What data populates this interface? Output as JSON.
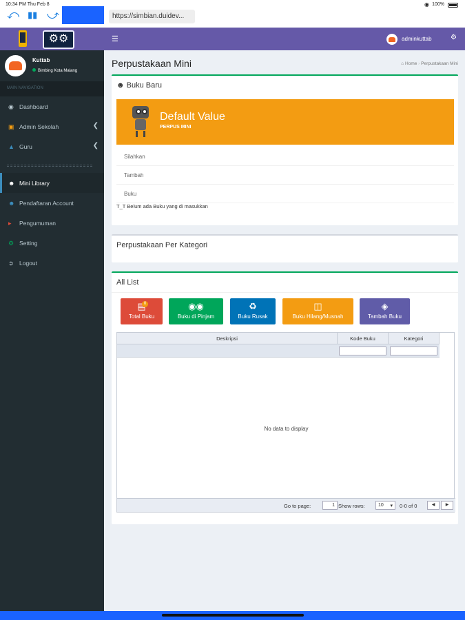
{
  "status_bar": {
    "time": "10:34 PM  Thu Feb 8",
    "battery": "100%"
  },
  "browser": {
    "url": "https://simbian.duidev..."
  },
  "sidebar": {
    "user": {
      "name": "Kuttab",
      "status": "Bimbing Kota Malang"
    },
    "nav_header": "MAIN NAVIGATION",
    "items": [
      {
        "label": "Dashboard",
        "icon": "dashboard-icon"
      },
      {
        "label": "Admin Sekolah",
        "icon": "briefcase-icon"
      },
      {
        "label": "Guru",
        "icon": "graduation-cap-icon"
      },
      {
        "label": "Mini Library",
        "icon": "users-icon"
      },
      {
        "label": "Pendaftaran Account",
        "icon": "user-plus-icon"
      },
      {
        "label": "Pengumuman",
        "icon": "bullhorn-icon"
      },
      {
        "label": "Setting",
        "icon": "gears-icon"
      },
      {
        "label": "Logout",
        "icon": "logout-icon"
      }
    ]
  },
  "topbar": {
    "username": "adminkuttab"
  },
  "page": {
    "title": "Perpustakaan Mini",
    "breadcrumb": {
      "home": "Home",
      "current": "Perpustakaan Mini"
    }
  },
  "buku_baru": {
    "title": "Buku Baru",
    "banner_title": "Default Value",
    "banner_subtitle": "PERPUS MINI",
    "rows": [
      "Silahkan",
      "Tambah",
      "Buku"
    ],
    "empty_note": "T_T Belum ada Buku yang di masukkan"
  },
  "kategori": {
    "title": "Perpustakaan Per Kategori"
  },
  "all_list": {
    "title": "All List",
    "buttons": [
      {
        "label": "Total Buku",
        "color": "#dd4b39",
        "icon": "book-icon",
        "badge": "0"
      },
      {
        "label": "Buku di Pinjam",
        "color": "#00a65a",
        "icon": "binoculars-icon"
      },
      {
        "label": "Buku Rusak",
        "color": "#0073b7",
        "icon": "recycle-icon"
      },
      {
        "label": "Buku Hilang/Musnah",
        "color": "#f39c12",
        "icon": "trash-icon"
      },
      {
        "label": "Tambah Buku",
        "color": "#605ca8",
        "icon": "tags-icon"
      }
    ],
    "table": {
      "columns": [
        "Deskripsi",
        "Kode Buku",
        "Kategori"
      ],
      "empty_message": "No data to display",
      "pager": {
        "go_to_label": "Go to page:",
        "page_value": "1",
        "show_rows_label": "Show rows:",
        "rows_value": "10",
        "range": "0-0 of 0"
      }
    }
  },
  "colors": {
    "header_purple": "#6559a8",
    "sidebar_dark": "#222d32",
    "accent_green": "#00a65a",
    "banner_orange": "#f39c12",
    "ios_blue": "#1a63ff"
  }
}
